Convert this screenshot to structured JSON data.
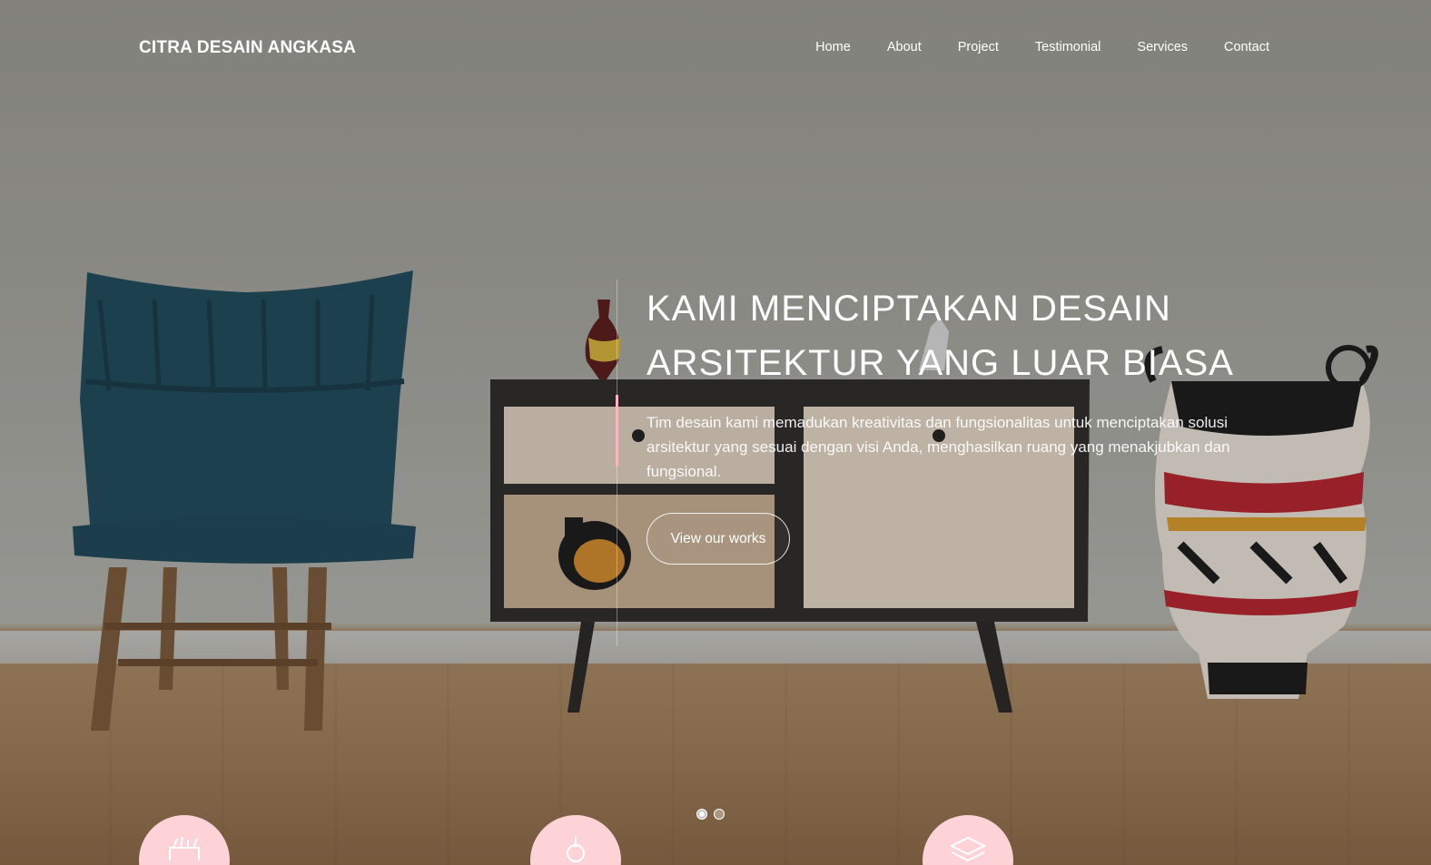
{
  "brand": {
    "name": "CITRA DESAIN ANGKASA"
  },
  "nav": {
    "items": [
      {
        "label": "Home"
      },
      {
        "label": "About"
      },
      {
        "label": "Project"
      },
      {
        "label": "Testimonial"
      },
      {
        "label": "Services"
      },
      {
        "label": "Contact"
      }
    ]
  },
  "hero": {
    "headline_line1": "KAMI MENCIPTAKAN DESAIN",
    "headline_line2": "ARSITEKTUR YANG LUAR BIASA",
    "lead": "Tim desain kami memadukan kreativitas dan fungsionalitas untuk menciptakan solusi arsitektur yang sesuai dengan visi Anda, menghasilkan ruang yang menakjubkan dan fungsional.",
    "cta_label": "View our works"
  },
  "slider": {
    "slides": 2,
    "active": 1
  },
  "features": {
    "icons": [
      "design-tools-icon",
      "lightbulb-icon",
      "layers-icon"
    ]
  },
  "colors": {
    "accent": "#f7b7c2",
    "feature_bg": "#fdd3d8",
    "text": "#ffffff"
  }
}
